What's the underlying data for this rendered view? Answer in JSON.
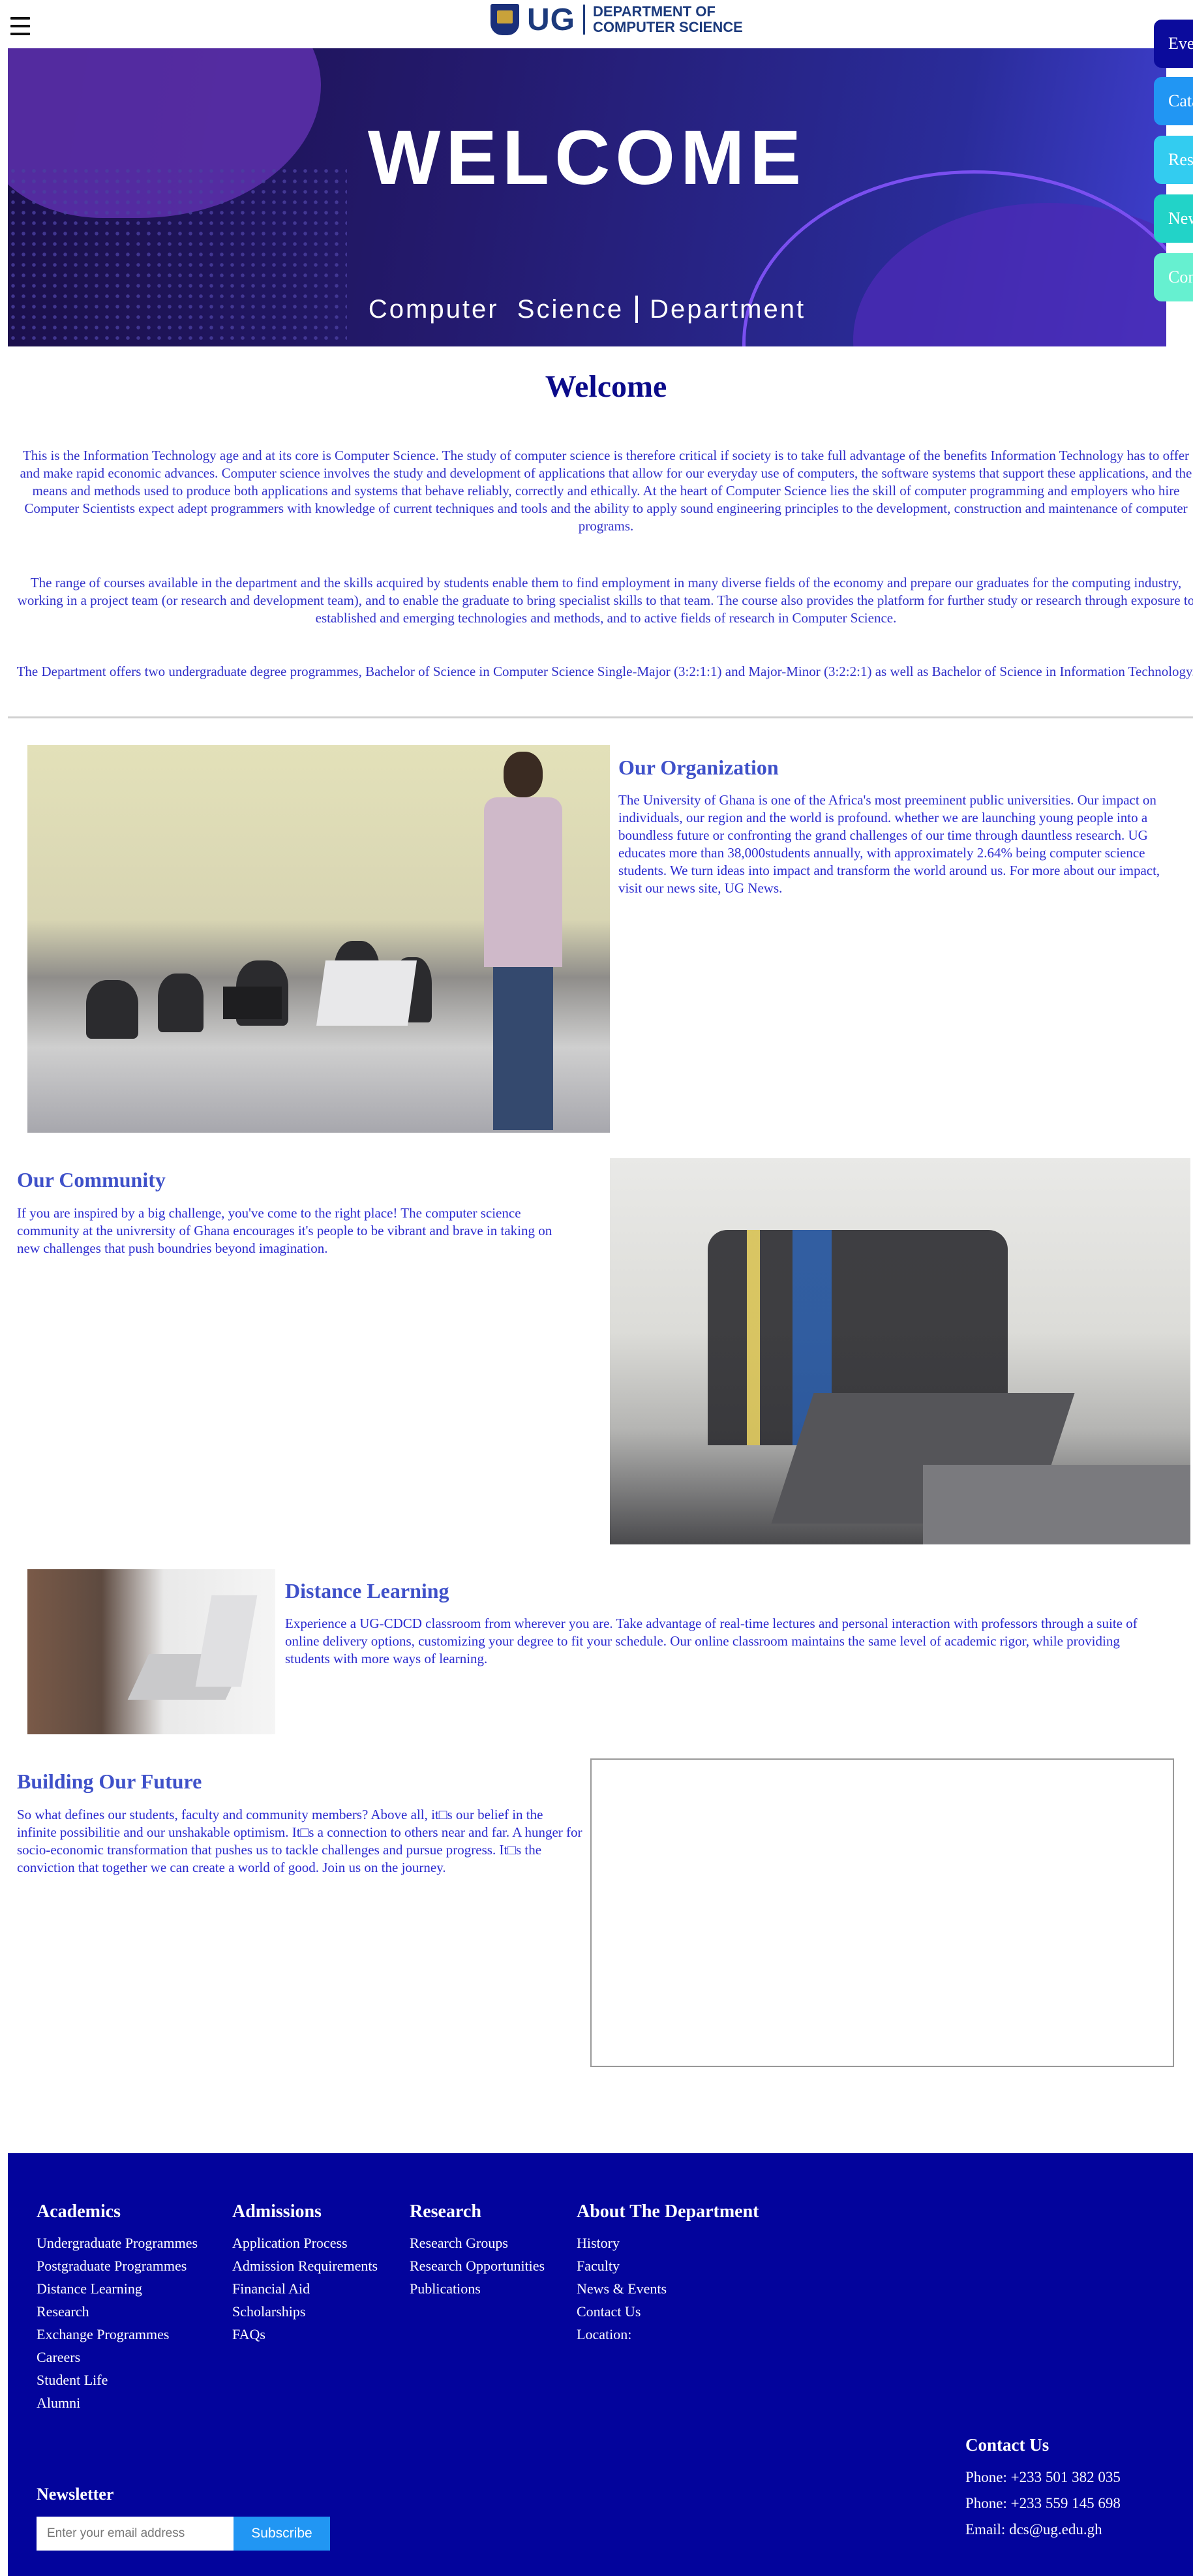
{
  "header": {
    "logo_ug": "UG",
    "logo_dept_line1": "DEPARTMENT OF",
    "logo_dept_line2": "COMPUTER SCIENCE"
  },
  "side_tabs": [
    {
      "label": "Events",
      "color": "#0b0b9c"
    },
    {
      "label": "Catalog",
      "color": "#2196f3"
    },
    {
      "label": "Research",
      "color": "#33ccf0"
    },
    {
      "label": "News",
      "color": "#22d3c8"
    },
    {
      "label": "Contact",
      "color": "#66f0d0"
    }
  ],
  "hero": {
    "title": "WELCOME",
    "subtitle_left": "Computer  Science",
    "subtitle_right": "Department"
  },
  "welcome": {
    "title": "Welcome",
    "paragraphs": [
      "This is the Information Technology age and at its core is Computer Science. The study of computer science is therefore critical if society is to take full advantage of the benefits Information Technology has to offer and make rapid economic advances. Computer science involves the study and development of applications that allow for our everyday use of computers, the software systems that support these applications, and the means and methods used to produce both applications and systems that behave reliably, correctly and ethically. At the heart of Computer Science lies the skill of computer programming and employers who hire Computer Scientists expect adept programmers with knowledge of current techniques and tools and the ability to apply sound engineering principles to the development, construction and maintenance of computer programs.",
      "The range of courses available in the department and the skills acquired by students enable them to find employment in many diverse fields of the economy and prepare our graduates for the computing industry, working in a project team (or research and development team), and to enable the graduate to bring specialist skills to that team. The course also provides the platform for further study or research through exposure to established and emerging technologies and methods, and to active fields of research in Computer Science.",
      "The Department offers two undergraduate degree programmes, Bachelor of Science in Computer Science Single-Major (3:2:1:1) and Major-Minor (3:2:2:1) as well as Bachelor of Science in Information Technology."
    ]
  },
  "organization": {
    "title": "Our Organization",
    "text": "The University of Ghana is one of the Africa's most preeminent public universities. Our impact on individuals, our region and the world is profound. whether we are launching young people into a boundless future or confronting the grand challenges of our time through dauntless research. UG educates more than 38,000students annually, with approximately 2.64% being computer science students. We turn ideas into impact and transform the world around us. For more about our impact, visit our news site, UG News."
  },
  "community": {
    "title": "Our Community",
    "text": "If you are inspired by a big challenge, you've come to the right place! The computer science community at the univrersity of Ghana encourages it's people to be vibrant and brave in taking on new challenges that push boundries beyond imagination."
  },
  "distance": {
    "title": "Distance Learning",
    "text": "Experience a UG-CDCD classroom from wherever you are. Take advantage of real-time lectures and personal interaction with professors through a suite of online delivery options, customizing your degree to fit your schedule. Our online classroom maintains the same level of academic rigor, while providing students with more ways of learning."
  },
  "future": {
    "title": "Building Our Future",
    "text": "So what defines our students, faculty and community members? Above all, it□s our belief in the infinite possibilitie and our unshakable optimism. It□s a connection to others near and far. A hunger for socio-economic transformation that pushes us to tackle challenges and pursue progress. It□s the conviction that together we can create a world of good. Join us on the journey."
  },
  "footer": {
    "academics": {
      "title": "Academics",
      "links": [
        "Undergraduate Programmes",
        "Postgraduate Programmes",
        "Distance Learning",
        "Research",
        "Exchange Programmes",
        "Careers",
        "Student Life",
        "Alumni"
      ]
    },
    "admissions": {
      "title": "Admissions",
      "links": [
        "Application Process",
        "Admission Requirements",
        "Financial Aid",
        "Scholarships",
        "FAQs"
      ]
    },
    "research": {
      "title": "Research",
      "links": [
        "Research Groups",
        "Research Opportunities",
        "Publications"
      ]
    },
    "about": {
      "title": "About The Department",
      "links": [
        "History",
        "Faculty",
        "News & Events",
        "Contact Us",
        "Location:"
      ]
    },
    "newsletter": {
      "title": "Newsletter",
      "placeholder": "Enter your email address",
      "button": "Subscribe"
    },
    "contact": {
      "title": "Contact Us",
      "phone1": "Phone: +233 501 382 035",
      "phone2": "Phone: +233 559 145 698",
      "email": "Email: dcs@ug.edu.gh"
    },
    "background": "#03049c"
  }
}
